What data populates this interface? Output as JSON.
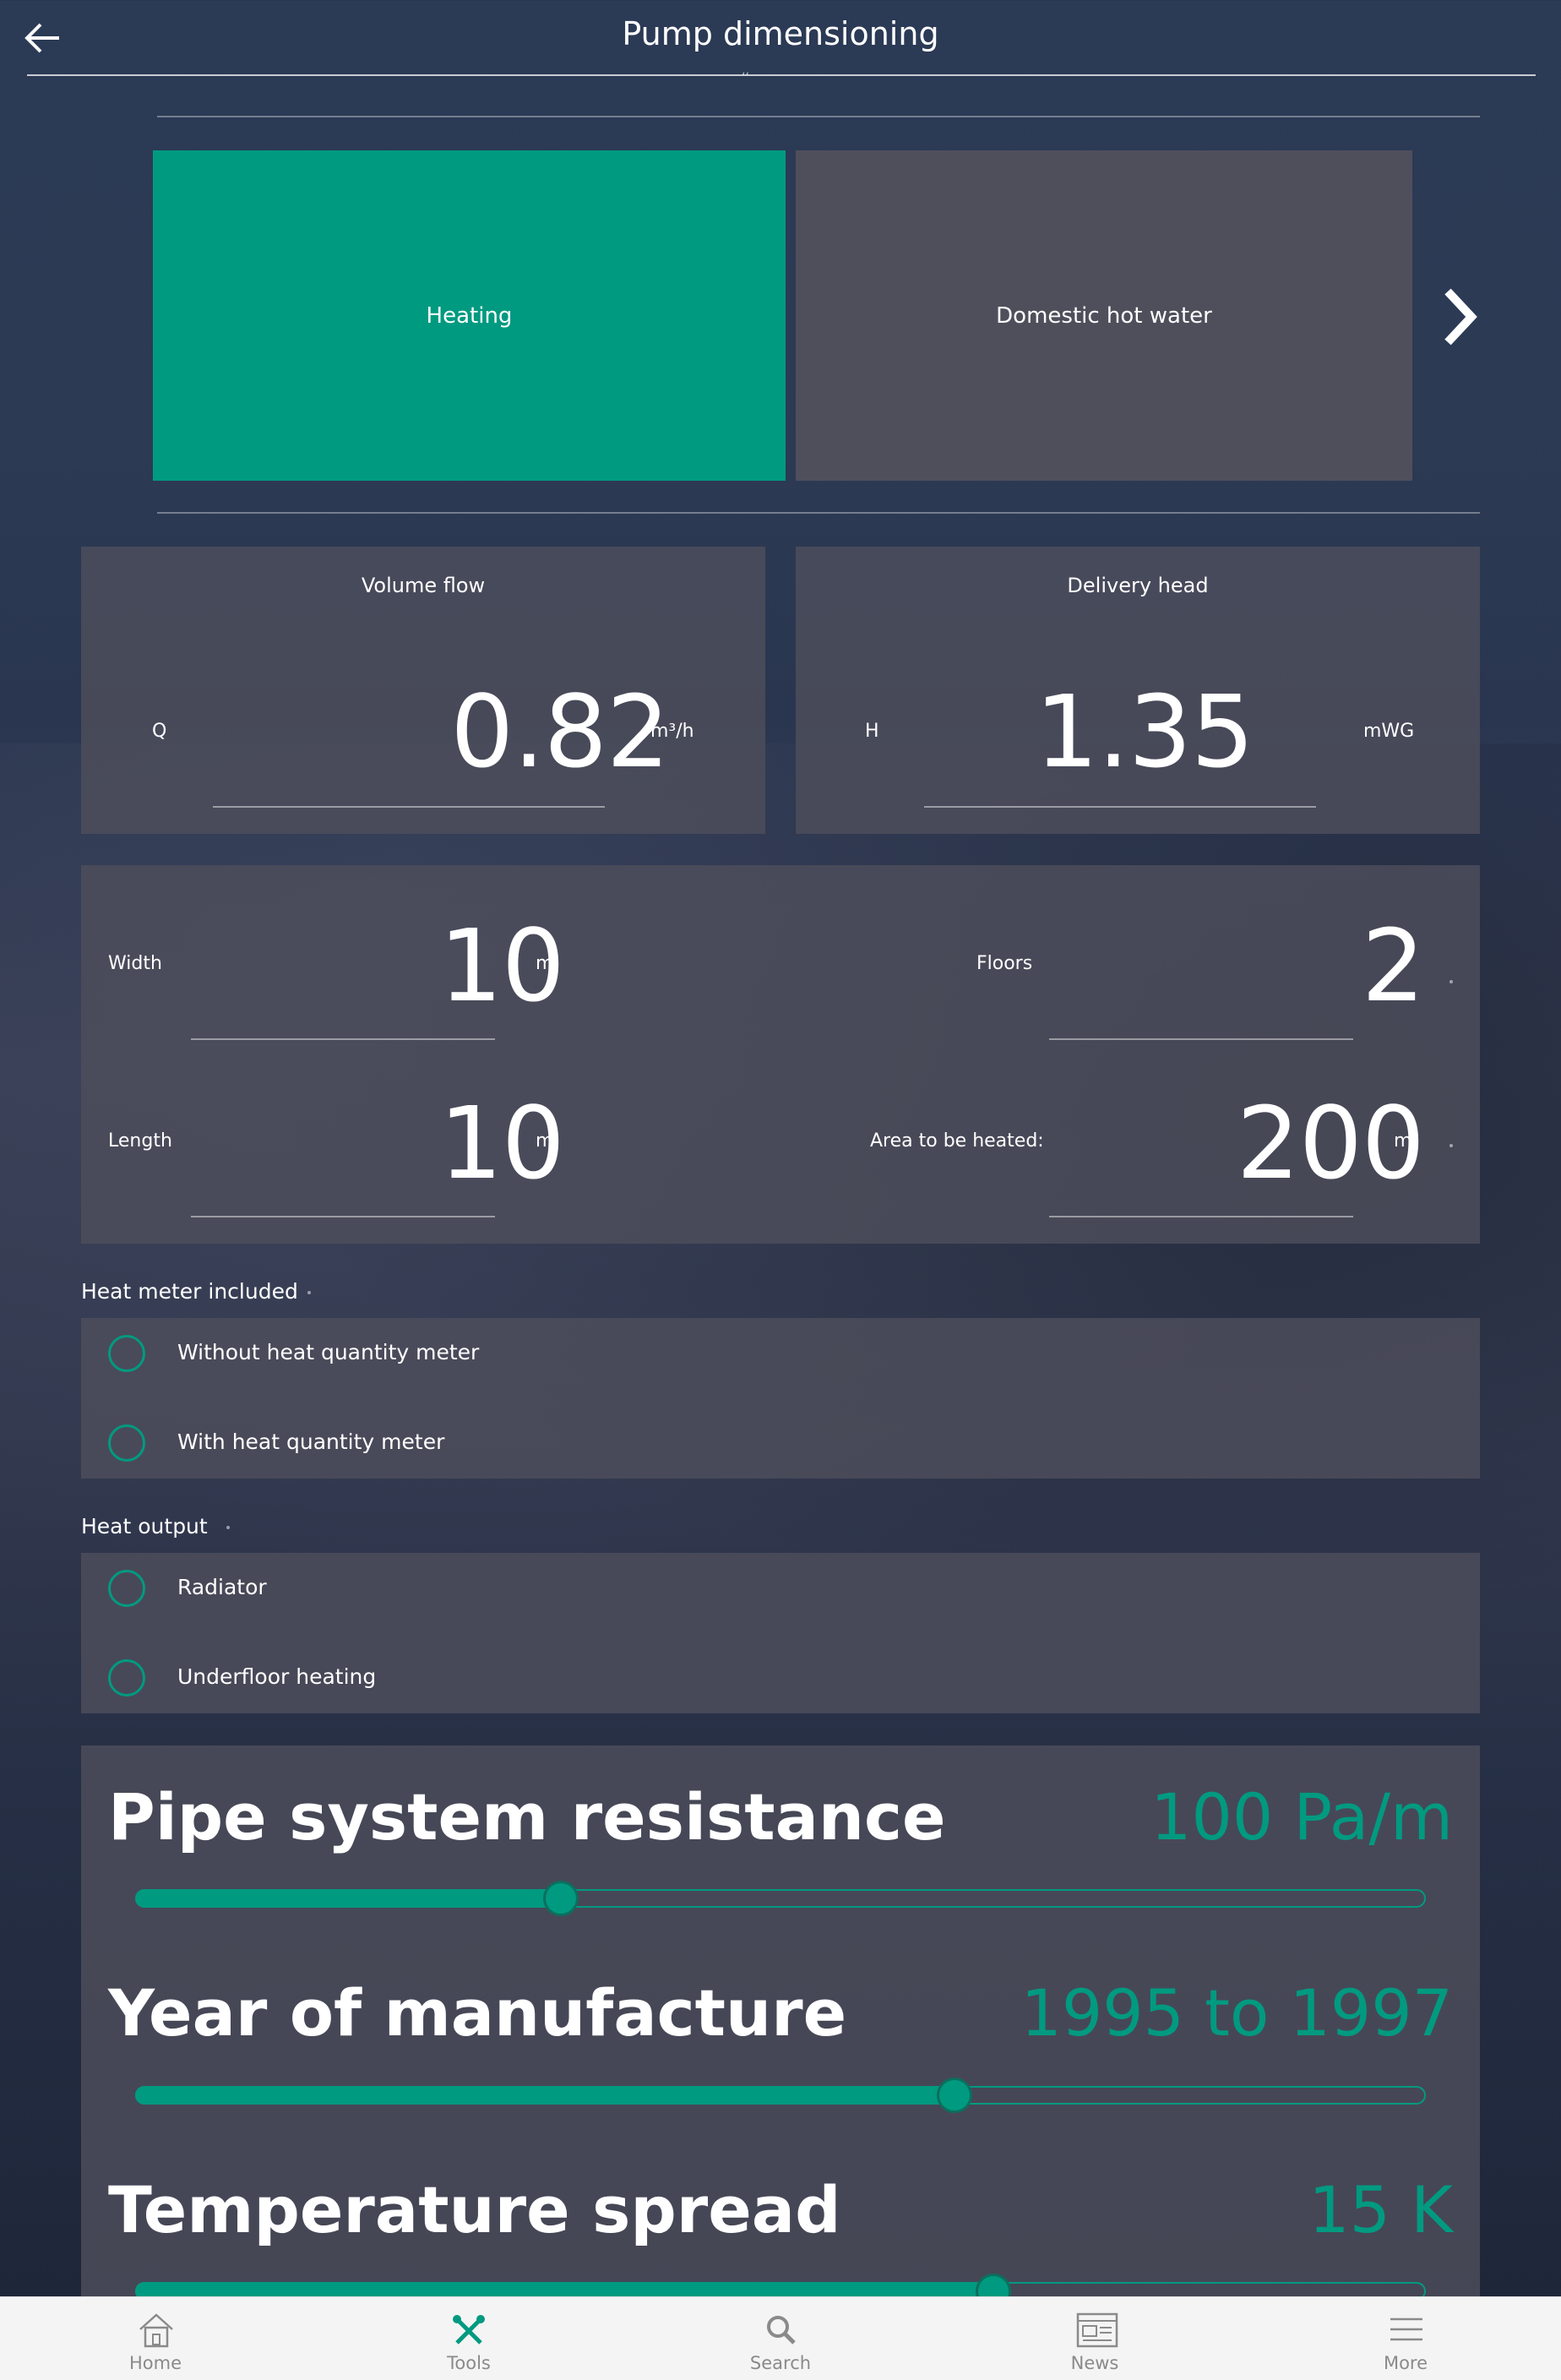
{
  "header": {
    "title": "Pump dimensioning"
  },
  "application": {
    "tiles": [
      {
        "label": "Heating",
        "selected": true
      },
      {
        "label": "Domestic hot water",
        "selected": false
      }
    ]
  },
  "results": {
    "volume_flow": {
      "title": "Volume flow",
      "symbol": "Q",
      "value": "0.82",
      "unit": "m³/h"
    },
    "delivery_head": {
      "title": "Delivery head",
      "symbol": "H",
      "value": "1.35",
      "unit": "mWG"
    }
  },
  "building": {
    "width": {
      "label": "Width",
      "value": "10",
      "unit": "m"
    },
    "length": {
      "label": "Length",
      "value": "10",
      "unit": "m"
    },
    "floors": {
      "label": "Floors",
      "value": "2"
    },
    "area": {
      "label": "Area to be heated:",
      "value": "200",
      "unit": "m²"
    }
  },
  "heat_meter": {
    "label": "Heat meter included",
    "options": [
      "Without heat quantity meter",
      "With heat quantity meter"
    ]
  },
  "heat_output": {
    "label": "Heat output",
    "options": [
      "Radiator",
      "Underfloor heating"
    ]
  },
  "sliders": [
    {
      "title": "Pipe system resistance",
      "value": "100 Pa/m",
      "position": 0.33
    },
    {
      "title": "Year of manufacture",
      "value": "1995 to 1997",
      "position": 0.635
    },
    {
      "title": "Temperature spread",
      "value": "15 K",
      "position": 0.665
    }
  ],
  "bottom_nav": {
    "items": [
      {
        "label": "Home",
        "icon": "home-icon"
      },
      {
        "label": "Tools",
        "icon": "tools-icon",
        "active": true
      },
      {
        "label": "Search",
        "icon": "search-icon"
      },
      {
        "label": "News",
        "icon": "news-icon"
      },
      {
        "label": "More",
        "icon": "menu-icon"
      }
    ]
  },
  "colors": {
    "accent": "#009a80",
    "tile_inactive": "#4f4f5c",
    "panel": "#4e4e5c"
  }
}
